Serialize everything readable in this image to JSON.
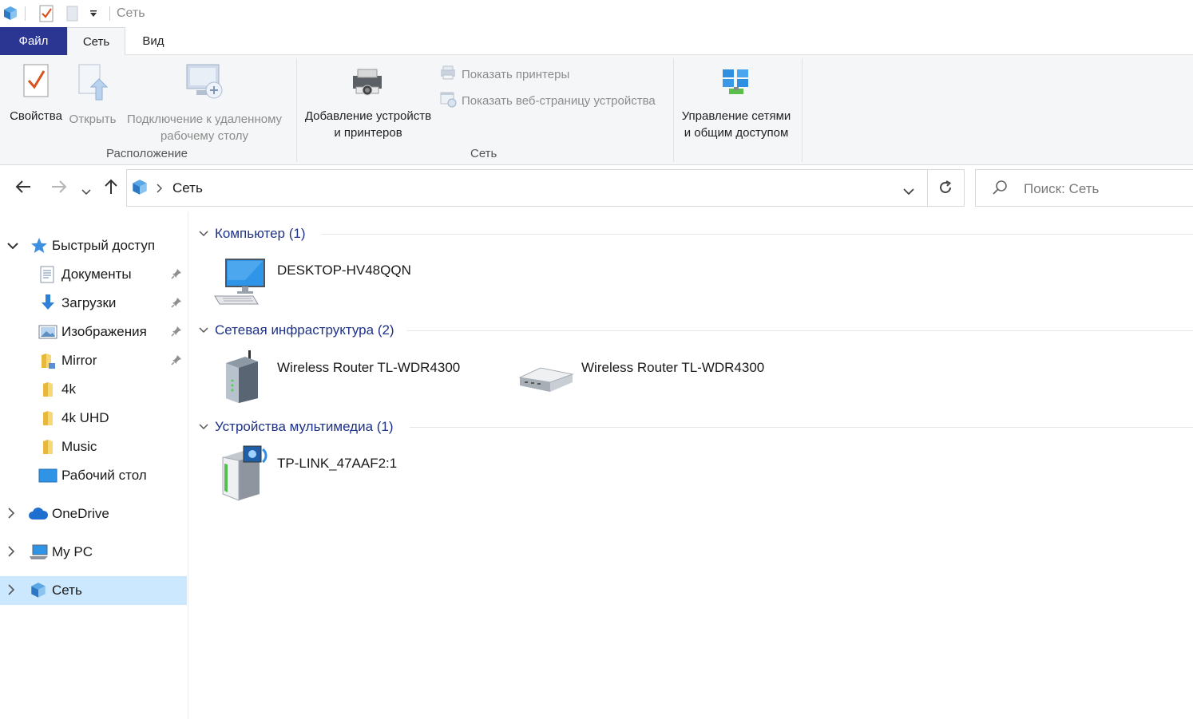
{
  "window": {
    "title": "Сеть"
  },
  "tabs": {
    "file": "Файл",
    "network": "Сеть",
    "view": "Вид"
  },
  "ribbon": {
    "location_group": {
      "label": "Расположение",
      "properties": "Свойства",
      "open": "Открыть",
      "remote_line1": "Подключение к удаленному",
      "remote_line2": "рабочему столу"
    },
    "network_group": {
      "label": "Сеть",
      "add_devices_line1": "Добавление устройств",
      "add_devices_line2": "и принтеров",
      "show_printers": "Показать принтеры",
      "show_device_page": "Показать веб-страницу устройства"
    },
    "manage": {
      "line1": "Управление сетями",
      "line2": "и общим доступом"
    }
  },
  "address": {
    "location": "Сеть",
    "search_placeholder": "Поиск: Сеть"
  },
  "sidebar": {
    "quick_access": "Быстрый доступ",
    "items": [
      {
        "label": "Документы"
      },
      {
        "label": "Загрузки"
      },
      {
        "label": "Изображения"
      },
      {
        "label": "Mirror"
      },
      {
        "label": "4k"
      },
      {
        "label": "4k UHD"
      },
      {
        "label": "Music"
      },
      {
        "label": "Рабочий стол"
      }
    ],
    "onedrive": "OneDrive",
    "mypc": "My PC",
    "network": "Сеть"
  },
  "content": {
    "groups": [
      {
        "title": "Компьютер (1)",
        "items": [
          {
            "name": "DESKTOP-HV48QQN"
          }
        ]
      },
      {
        "title": "Сетевая инфраструктура (2)",
        "items": [
          {
            "name": "Wireless Router TL-WDR4300"
          },
          {
            "name": "Wireless Router TL-WDR4300"
          }
        ]
      },
      {
        "title": "Устройства мультимедиа (1)",
        "items": [
          {
            "name": "TP-LINK_47AAF2:1"
          }
        ]
      }
    ]
  }
}
